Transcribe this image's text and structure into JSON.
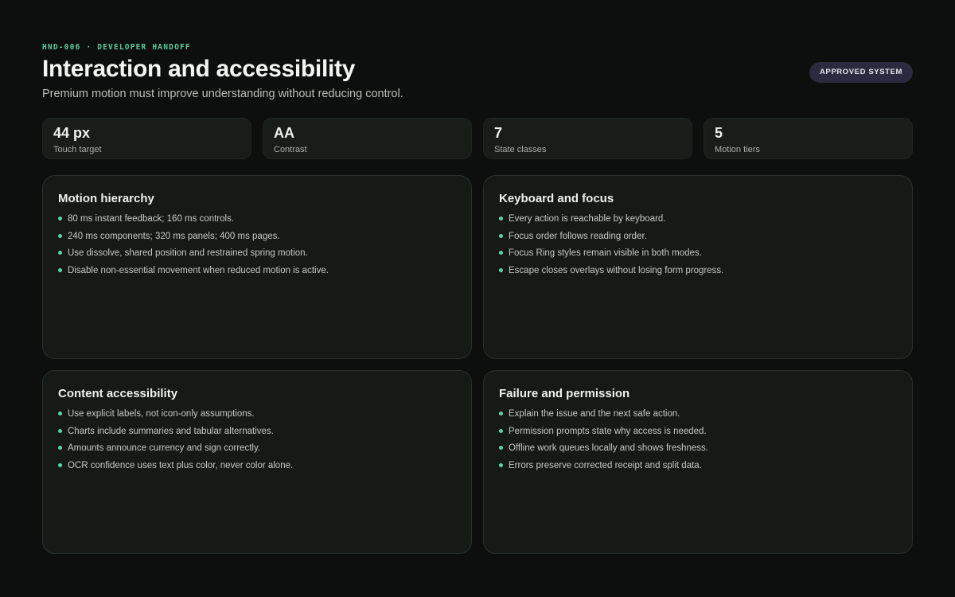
{
  "header": {
    "eyebrow": "HND-006 · DEVELOPER HANDOFF",
    "title": "Interaction and accessibility",
    "subtitle": "Premium motion must improve understanding without reducing control.",
    "badge": "APPROVED SYSTEM"
  },
  "metrics": [
    {
      "value": "44 px",
      "label": "Touch target"
    },
    {
      "value": "AA",
      "label": "Contrast"
    },
    {
      "value": "7",
      "label": "State classes"
    },
    {
      "value": "5",
      "label": "Motion tiers"
    }
  ],
  "cards": [
    {
      "title": "Motion hierarchy",
      "items": [
        "80 ms instant feedback; 160 ms controls.",
        "240 ms components; 320 ms panels; 400 ms pages.",
        "Use dissolve, shared position and restrained spring motion.",
        "Disable non-essential movement when reduced motion is active."
      ]
    },
    {
      "title": "Keyboard and focus",
      "items": [
        "Every action is reachable by keyboard.",
        "Focus order follows reading order.",
        "Focus Ring styles remain visible in both modes.",
        "Escape closes overlays without losing form progress."
      ]
    },
    {
      "title": "Content accessibility",
      "items": [
        "Use explicit labels, not icon-only assumptions.",
        "Charts include summaries and tabular alternatives.",
        "Amounts announce currency and sign correctly.",
        "OCR confidence uses text plus color, never color alone."
      ]
    },
    {
      "title": "Failure and permission",
      "items": [
        "Explain the issue and the next safe action.",
        "Permission prompts state why access is needed.",
        "Offline work queues locally and shows freshness.",
        "Errors preserve corrected receipt and split data."
      ]
    }
  ],
  "colors": {
    "background": "#0c0f0d",
    "accent": "#5fd3a6",
    "badge_bg": "#2c2a3e",
    "card_bg": "#151a17"
  }
}
